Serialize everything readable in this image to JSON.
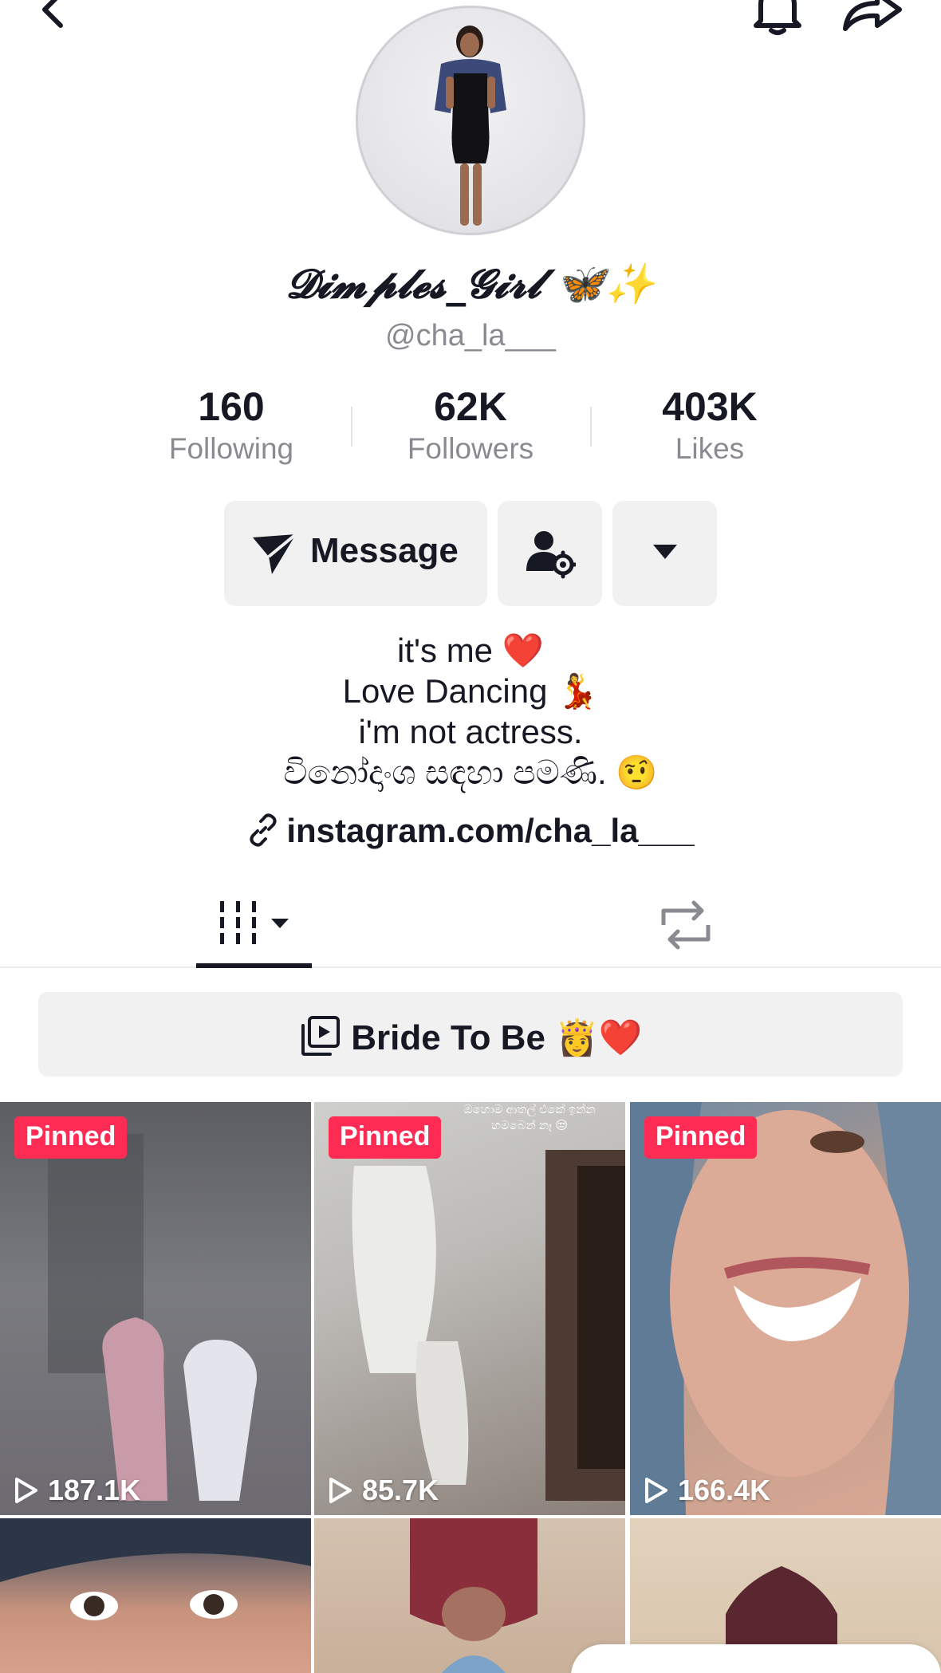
{
  "header": {
    "back_icon": "chevron-left-icon",
    "notify_icon": "bell-icon",
    "share_icon": "share-arrow-icon"
  },
  "profile": {
    "display_name": "𝓓𝓲𝓶𝓹𝓵𝓮𝓼_𝓖𝓲𝓻𝓵 🦋✨",
    "username": "@cha_la___"
  },
  "stats": [
    {
      "value": "160",
      "label": "Following"
    },
    {
      "value": "62K",
      "label": "Followers"
    },
    {
      "value": "403K",
      "label": "Likes"
    }
  ],
  "actions": {
    "message_label": "Message",
    "message_icon": "send-plane-icon",
    "friend_settings_icon": "person-gear-icon",
    "more_icon": "caret-down-icon"
  },
  "bio": {
    "line1": "it's me ❤️",
    "line2": "Love Dancing 💃",
    "line3": "i'm not actress.",
    "line4": "විනෝදාංශ සඳහා පමණි. 🤨",
    "link": "instagram.com/cha_la___"
  },
  "tabs": {
    "videos_icon": "video-grid-icon",
    "repost_icon": "repost-icon"
  },
  "playlist": {
    "label": "Bride To Be 👸❤️",
    "icon": "playlist-icon"
  },
  "videos": [
    {
      "pinned": "Pinned",
      "views": "187.1K"
    },
    {
      "pinned": "Pinned",
      "views": "85.7K",
      "overlay": "ඔහොම ආතල් එකේ ඉන්න\nහමබෙන් නෑ 😒"
    },
    {
      "pinned": "Pinned",
      "views": "166.4K"
    }
  ],
  "colors": {
    "accent": "#fe2c55",
    "text": "#161823",
    "muted": "#8a8b91",
    "button_bg": "#f1f1f2"
  }
}
